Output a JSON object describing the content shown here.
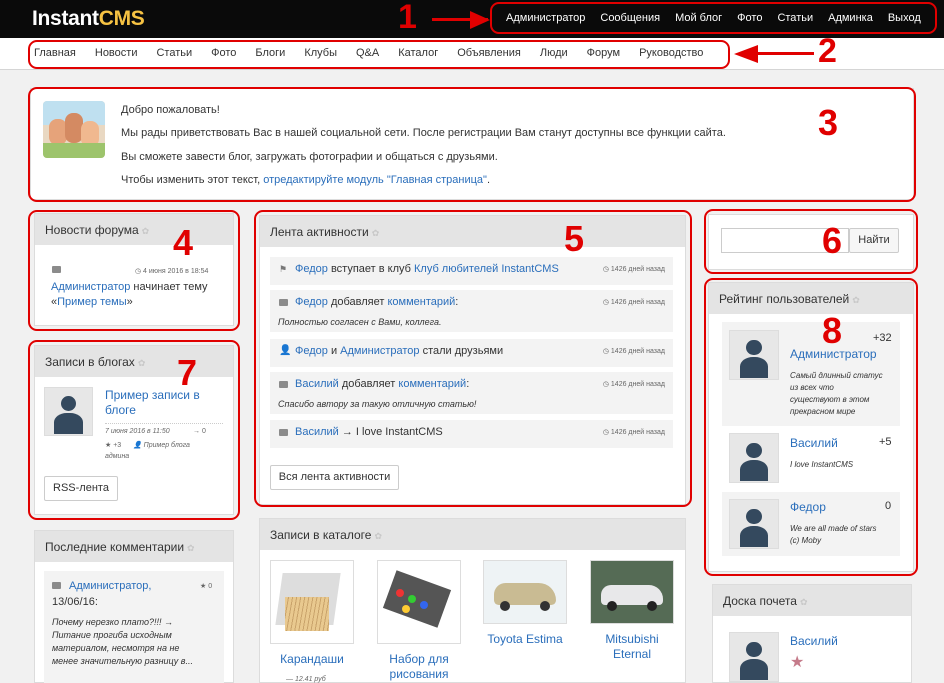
{
  "header": {
    "logo_main": "Instant",
    "logo_accent": "CMS",
    "topnav": [
      "Администратор",
      "Сообщения",
      "Мой блог",
      "Фото",
      "Статьи",
      "Админка",
      "Выход"
    ]
  },
  "mainnav": [
    "Главная",
    "Новости",
    "Статьи",
    "Фото",
    "Блоги",
    "Клубы",
    "Q&A",
    "Каталог",
    "Объявления",
    "Люди",
    "Форум",
    "Руководство"
  ],
  "welcome": {
    "title": "Добро пожаловать!",
    "line1": "Мы рады приветствовать Вас в нашей социальной сети. После регистрации Вам станут доступны все функции сайта.",
    "line2": "Вы сможете завести блог, загружать фотографии и общаться с друзьями.",
    "line3_prefix": "Чтобы изменить этот текст, ",
    "line3_link": "отредактируйте модуль \"Главная страница\"",
    "line3_suffix": "."
  },
  "forum_news": {
    "title": "Новости форума",
    "time": "◷ 4 июня 2016 в 18:54",
    "author": "Администратор",
    "action": " начинает тему",
    "topic_prefix": "«",
    "topic": "Пример темы",
    "topic_suffix": "»"
  },
  "blogs": {
    "title": "Записи в блогах",
    "post_title_1": "Пример записи в",
    "post_title_2": "блоге",
    "date": "7 июня 2016 в 11:50",
    "comments": "→ 0",
    "rating": "★ +3",
    "blog_name_1": "Пример блога",
    "blog_name_2": "админа",
    "rss": "RSS-лента"
  },
  "comments": {
    "title": "Последние комментарии",
    "author": "Администратор,",
    "date": "13/06/16:",
    "score": "★ 0",
    "text": [
      "Почему нерезко плато?!!! →",
      "Питание прогиба исходным",
      "материалом, несмотря на не",
      "менее значительную разницу в..."
    ]
  },
  "activity": {
    "title": "Лента активности",
    "rows": [
      {
        "parts": [
          "Федор",
          " вступает в клуб ",
          "Клуб любителей InstantCMS"
        ],
        "time": "◷ 1426 дней назад",
        "quote": ""
      },
      {
        "parts": [
          "Федор",
          " добавляет ",
          "комментарий",
          ":"
        ],
        "time": "◷ 1426 дней назад",
        "quote": "Полностью согласен с Вами, коллега."
      },
      {
        "parts": [
          "Федор",
          " и ",
          "Администратор",
          " стали друзьями"
        ],
        "time": "◷ 1426 дней назад",
        "quote": ""
      },
      {
        "parts": [
          "Василий",
          " добавляет ",
          "комментарий",
          ":"
        ],
        "time": "◷ 1426 дней назад",
        "quote": "Спасибо автору за такую отличную статью!"
      },
      {
        "parts": [
          "Василий",
          " → I love InstantCMS"
        ],
        "time": "◷ 1426 дней назад",
        "quote": ""
      }
    ],
    "all_button": "Вся лента активности"
  },
  "catalog": {
    "title": "Записи в каталоге",
    "items": [
      {
        "name": [
          "Карандаши"
        ],
        "price": "— 12.41 руб"
      },
      {
        "name": [
          "Набор для",
          "рисования"
        ]
      },
      {
        "name": [
          "Toyota Estima"
        ]
      },
      {
        "name": [
          "Mitsubishi",
          "Eternal"
        ]
      }
    ]
  },
  "search": {
    "button": "Найти",
    "value": ""
  },
  "rating": {
    "title": "Рейтинг пользователей",
    "users": [
      {
        "name": "Администратор",
        "score": "+32",
        "status": [
          "Самый длинный статус",
          "из всех что",
          "существуют в этом",
          "прекрасном мире"
        ]
      },
      {
        "name": "Василий",
        "score": "+5",
        "status": [
          "I love InstantCMS"
        ]
      },
      {
        "name": "Федор",
        "score": "0",
        "status": [
          "We are all made of stars",
          "(c) Moby"
        ]
      }
    ]
  },
  "honor": {
    "title": "Доска почета",
    "user": "Василий",
    "star": "★"
  },
  "markers": [
    "1",
    "2",
    "3",
    "4",
    "5",
    "6",
    "7",
    "8"
  ]
}
